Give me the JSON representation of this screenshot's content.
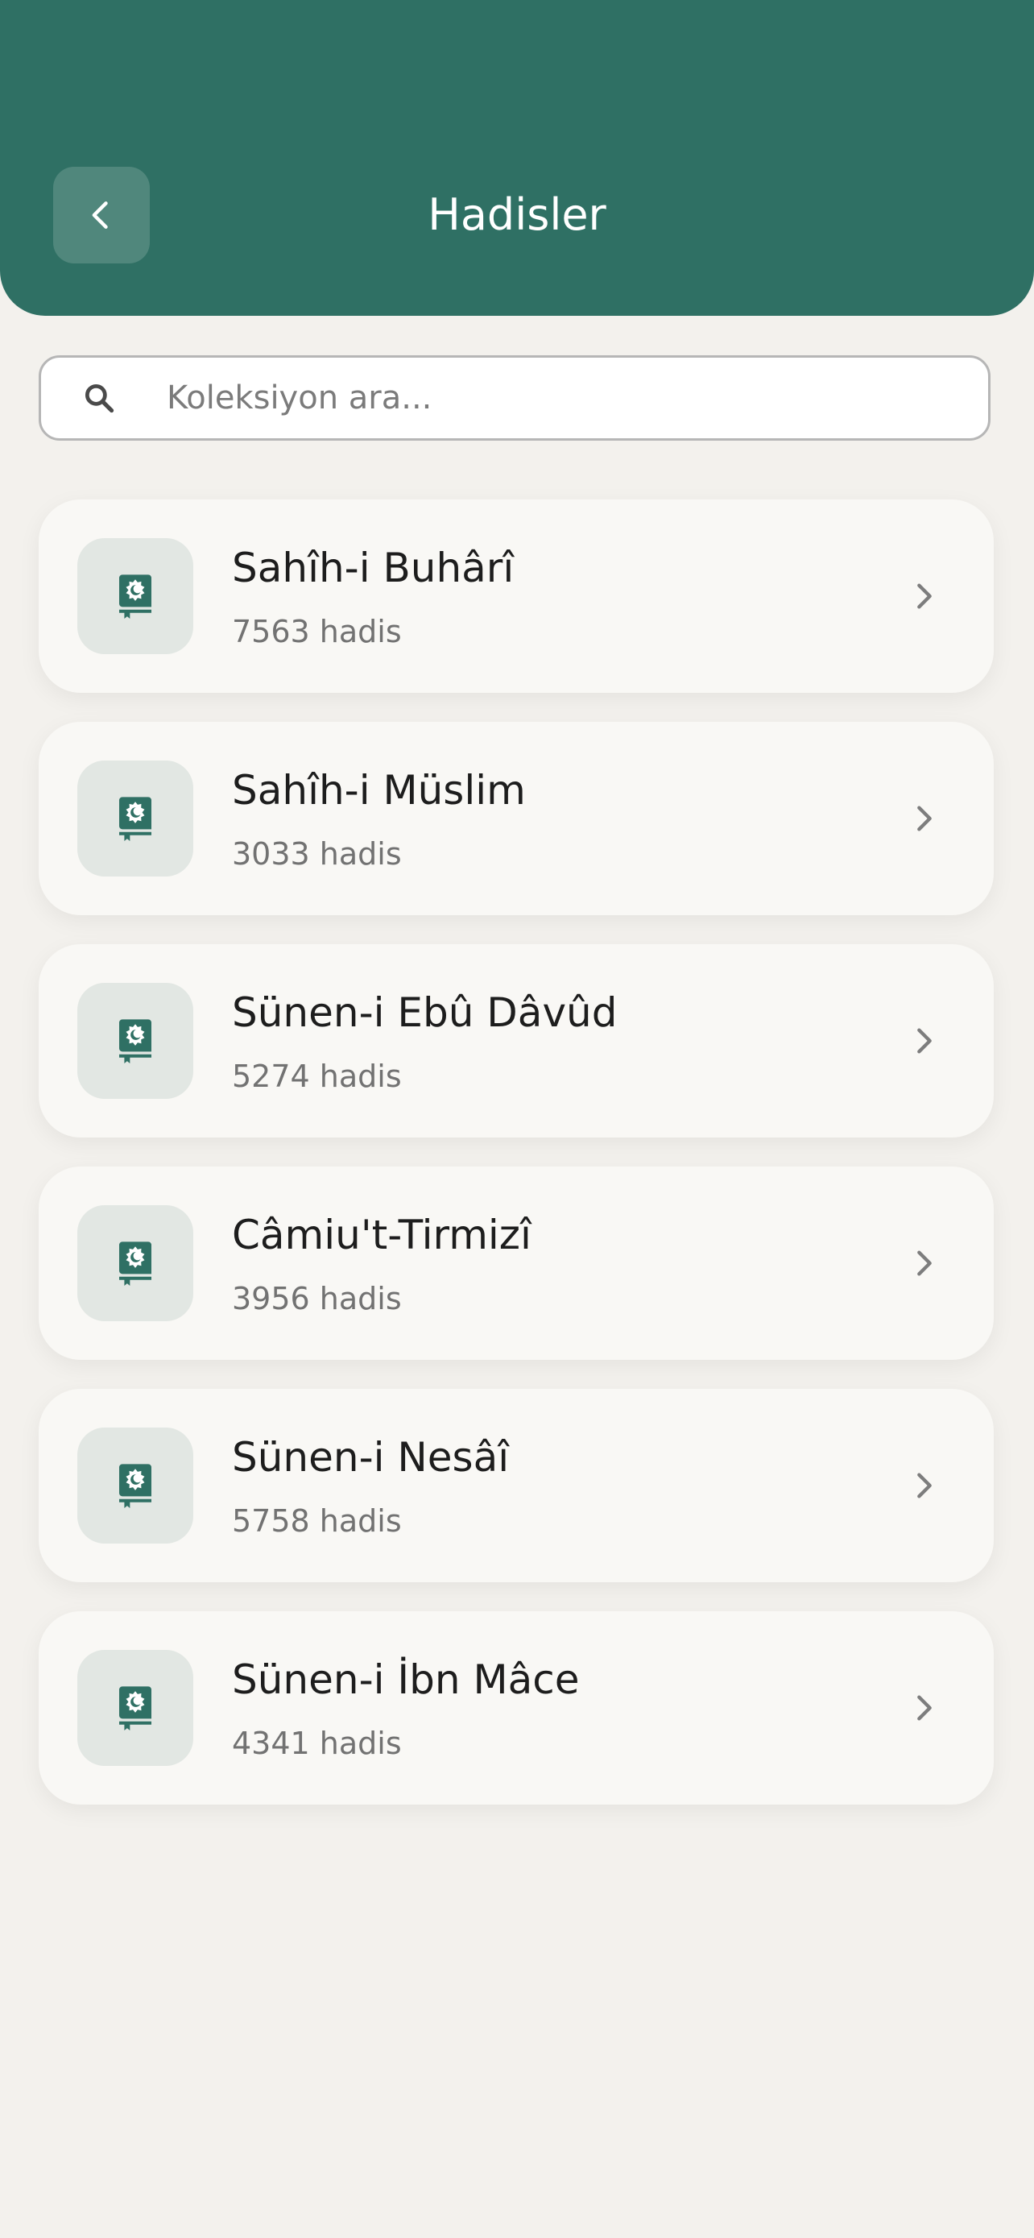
{
  "header": {
    "title": "Hadisler",
    "bg_color": "#2f7064"
  },
  "search": {
    "placeholder": "Koleksiyon ara..."
  },
  "collections": [
    {
      "title": "Sahîh-i Buhârî",
      "count": "7563 hadis"
    },
    {
      "title": "Sahîh-i Müslim",
      "count": "3033 hadis"
    },
    {
      "title": "Sünen-i Ebû Dâvûd",
      "count": "5274 hadis"
    },
    {
      "title": "Câmiu't-Tirmizî",
      "count": "3956 hadis"
    },
    {
      "title": "Sünen-i Nesâî",
      "count": "5758 hadis"
    },
    {
      "title": "Sünen-i İbn Mâce",
      "count": "4341 hadis"
    }
  ],
  "icons": {
    "back": "chevron-left-icon",
    "search": "search-icon",
    "collection": "quran-book-icon",
    "row_arrow": "chevron-right-icon"
  }
}
